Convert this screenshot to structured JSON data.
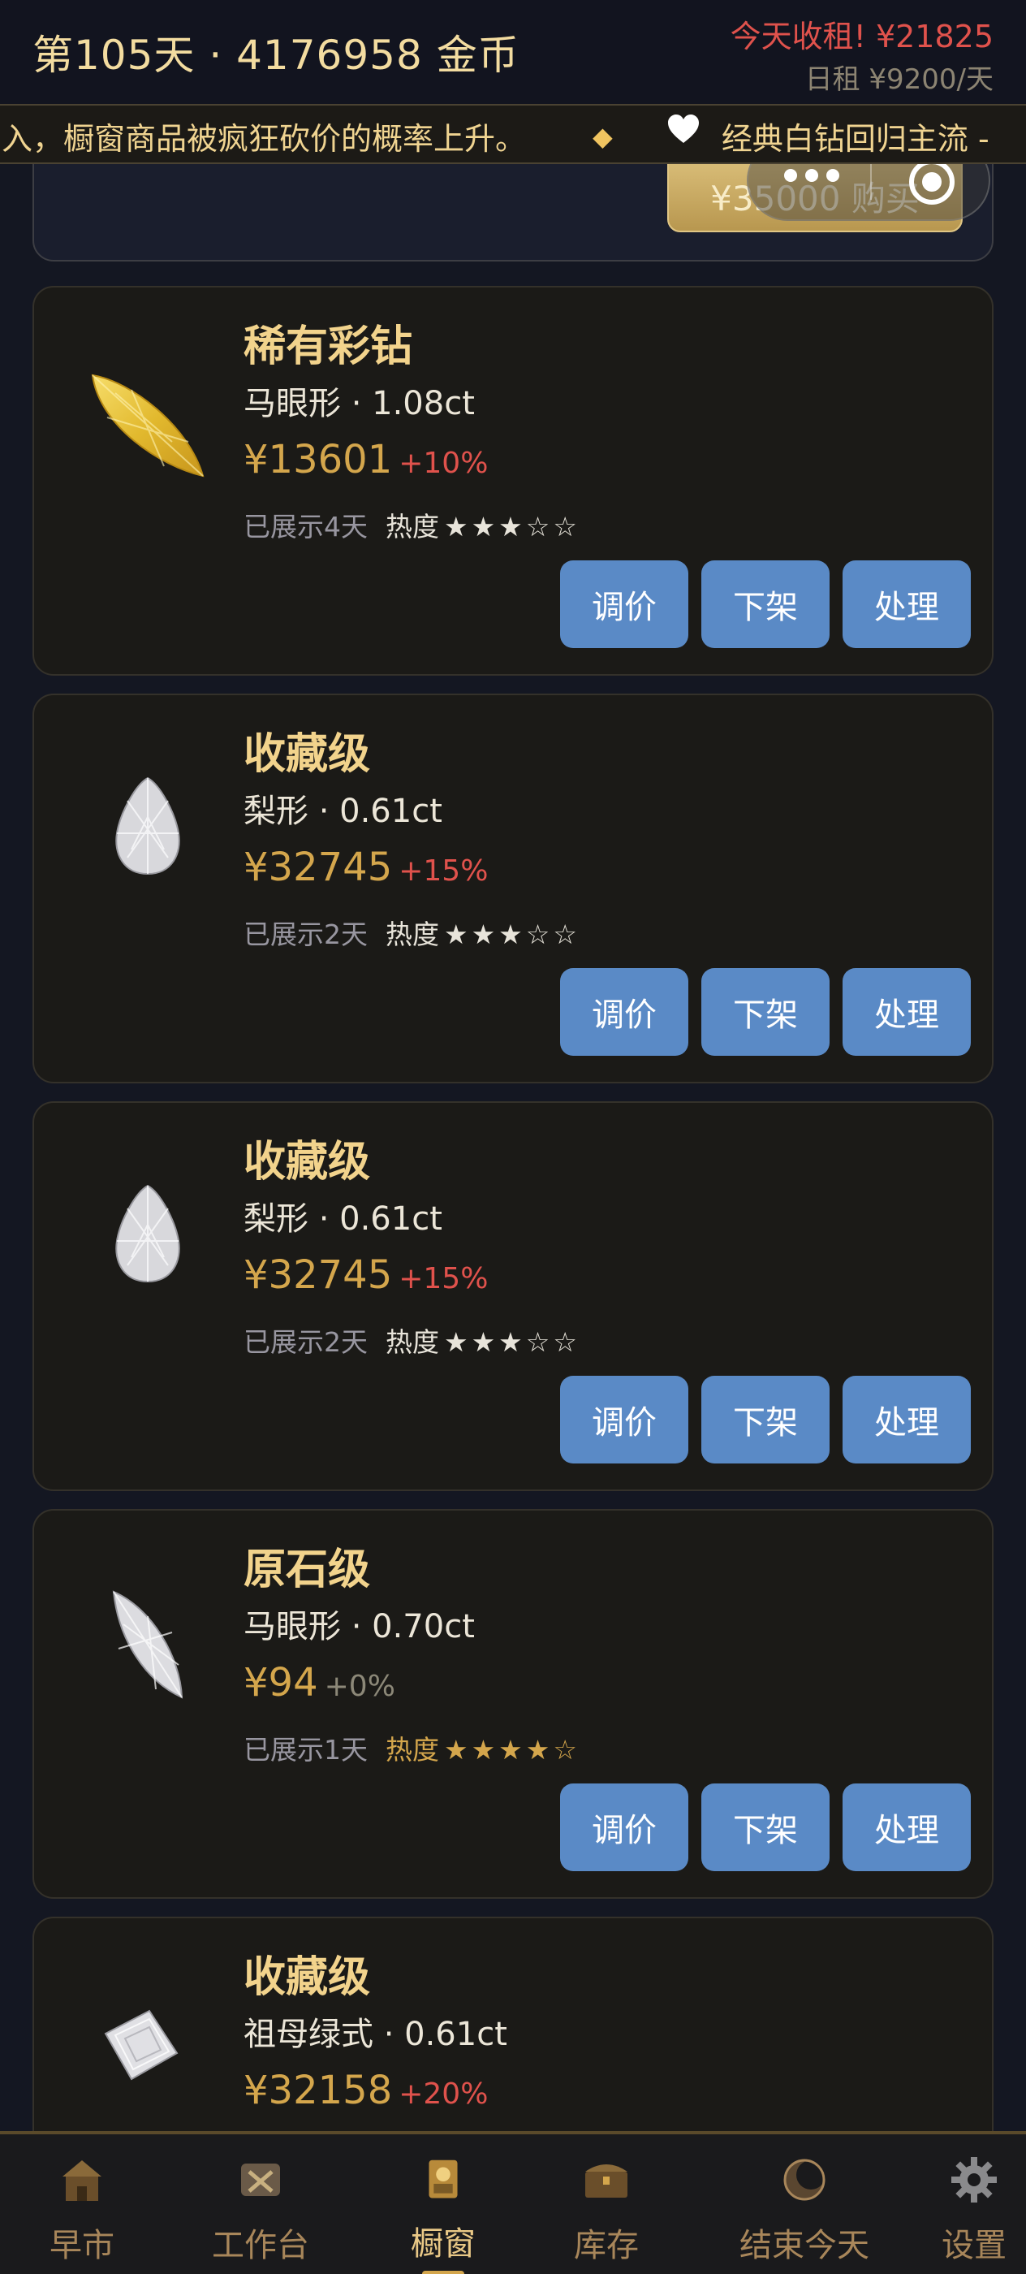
{
  "header": {
    "title": "第105天 · 4176958 金币",
    "income": "今天收租! ¥21825",
    "rent": "日租 ¥9200/天"
  },
  "ticker": {
    "message_a": "涌入，橱窗商品被疯狂砍价的概率上升。",
    "separator": "◆",
    "message_b": "经典白钻回归主流 -"
  },
  "top_card": {
    "buy_label": "¥35000 购买"
  },
  "cards": [
    {
      "name": "稀有彩钻",
      "spec": "马眼形 · 1.08ct",
      "price": "¥13601",
      "change": "+10%",
      "days": "已展示4天",
      "heat_label": "热度",
      "stars": "★★★☆☆",
      "gem": "yellow-marquise",
      "heat_level": 3
    },
    {
      "name": "收藏级",
      "spec": "梨形 · 0.61ct",
      "price": "¥32745",
      "change": "+15%",
      "days": "已展示2天",
      "heat_label": "热度",
      "stars": "★★★☆☆",
      "gem": "white-pear",
      "heat_level": 3
    },
    {
      "name": "收藏级",
      "spec": "梨形 · 0.61ct",
      "price": "¥32745",
      "change": "+15%",
      "days": "已展示2天",
      "heat_label": "热度",
      "stars": "★★★☆☆",
      "gem": "white-pear",
      "heat_level": 3
    },
    {
      "name": "原石级",
      "spec": "马眼形 · 0.70ct",
      "price": "¥94",
      "change": "+0%",
      "days": "已展示1天",
      "heat_label": "热度",
      "stars": "★★★★☆",
      "gem": "white-marquise",
      "heat_level": 4
    },
    {
      "name": "收藏级",
      "spec": "祖母绿式 · 0.61ct",
      "price": "¥32158",
      "change": "+20%",
      "gem": "white-emerald"
    }
  ],
  "actions": {
    "adjust": "调价",
    "delist": "下架",
    "handle": "处理"
  },
  "tabs": [
    {
      "label": "早市",
      "icon": "market-icon"
    },
    {
      "label": "工作台",
      "icon": "workbench-icon"
    },
    {
      "label": "橱窗",
      "icon": "showcase-icon",
      "active": true
    },
    {
      "label": "库存",
      "icon": "chest-icon"
    },
    {
      "label": "结束今天",
      "icon": "moon-icon"
    },
    {
      "label": "设置",
      "icon": "gear-icon"
    }
  ],
  "colors": {
    "background": "#141722",
    "card": "#1b1a17",
    "gold": "#d4a64c",
    "button": "#5a8ac6",
    "positive_change": "#e0524c"
  }
}
